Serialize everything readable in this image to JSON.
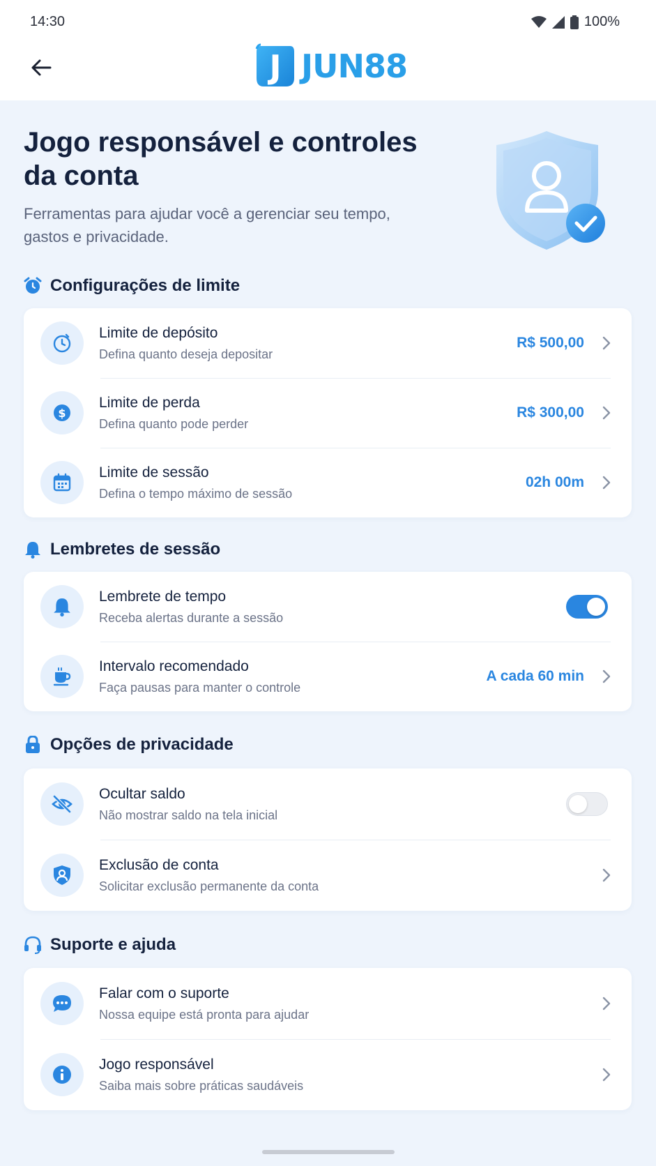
{
  "status_bar": {
    "time": "14:30",
    "battery": "100%"
  },
  "header": {
    "logo_text": "JUN88",
    "logo_letter": "J"
  },
  "hero": {
    "title": "Jogo responsável e controles da conta",
    "subtitle": "Ferramentas para ajudar você a gerenciar seu tempo, gastos e privacidade."
  },
  "sections": {
    "limits": {
      "title": "Configurações de limite",
      "icon": "alarm-clock-icon",
      "items": [
        {
          "title": "Limite de depósito",
          "subtitle": "Defina quanto deseja depositar",
          "value": "R$ 500,00",
          "icon": "clock-icon"
        },
        {
          "title": "Limite de perda",
          "subtitle": "Defina quanto pode perder",
          "value": "R$ 300,00",
          "icon": "dollar-icon"
        },
        {
          "title": "Limite de sessão",
          "subtitle": "Defina o tempo máximo de sessão",
          "value": "02h 00m",
          "icon": "calendar-icon"
        }
      ]
    },
    "reminders": {
      "title": "Lembretes de sessão",
      "icon": "bell-icon",
      "items": [
        {
          "title": "Lembrete de tempo",
          "subtitle": "Receba alertas durante a sessão",
          "toggle": true,
          "icon": "bell-icon"
        },
        {
          "title": "Intervalo recomendado",
          "subtitle": "Faça pausas para manter o controle",
          "value": "A cada 60 min",
          "icon": "coffee-cup-icon"
        }
      ]
    },
    "privacy": {
      "title": "Opções de privacidade",
      "icon": "lock-icon",
      "items": [
        {
          "title": "Ocultar saldo",
          "subtitle": "Não mostrar saldo na tela inicial",
          "toggle": false,
          "icon": "eye-off-icon"
        },
        {
          "title": "Exclusão de conta",
          "subtitle": "Solicitar exclusão permanente da conta",
          "icon": "user-shield-icon"
        }
      ]
    },
    "support": {
      "title": "Suporte e ajuda",
      "icon": "headset-icon",
      "items": [
        {
          "title": "Falar com o suporte",
          "subtitle": "Nossa equipe está pronta para ajudar",
          "icon": "chat-icon"
        },
        {
          "title": "Jogo responsável",
          "subtitle": "Saiba mais sobre práticas saudáveis",
          "icon": "info-icon"
        }
      ]
    }
  },
  "colors": {
    "accent": "#2a86e0",
    "logo": "#2a9fe8",
    "background": "#eef4fc",
    "title": "#14213d"
  }
}
